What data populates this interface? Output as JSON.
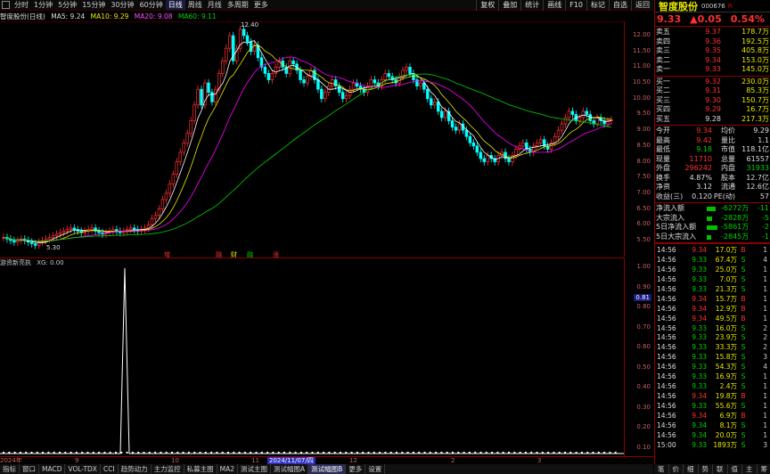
{
  "toolbar": {
    "periods": [
      "分时",
      "1分钟",
      "5分钟",
      "15分钟",
      "30分钟",
      "60分钟",
      "日线",
      "周线",
      "月线",
      "多周期",
      "更多"
    ],
    "active": "日线",
    "right": [
      "复权",
      "叠加",
      "统计",
      "画线",
      "F10",
      "标记",
      "自选",
      "返回"
    ]
  },
  "title": {
    "name": "智度股份(日线)",
    "ma5": "MA5: 9.24",
    "ma10": "MA10: 9.29",
    "ma20": "MA20: 9.08",
    "ma60": "MA60: 9.11"
  },
  "price_axis": [
    "12.00",
    "11.50",
    "11.00",
    "10.50",
    "10.00",
    "9.50",
    "9.00",
    "8.50",
    "8.00",
    "7.50",
    "7.00",
    "6.50",
    "6.00",
    "5.50"
  ],
  "markers": {
    "high": "12.40",
    "low": "5.30"
  },
  "events": [
    {
      "t": "增",
      "c": "#ff3030"
    },
    {
      "t": "融",
      "c": "#ff3030"
    },
    {
      "t": "财",
      "c": "#e8e800"
    },
    {
      "t": "融",
      "c": "#00d000"
    },
    {
      "t": "涨",
      "c": "#ff3030"
    }
  ],
  "indicator": {
    "name": "游资新亮执",
    "value": "XG: 0.00",
    "current": "0.81"
  },
  "sub_axis": [
    "1.00",
    "0.90",
    "0.80",
    "0.70",
    "0.60",
    "0.50",
    "0.40",
    "0.30",
    "0.20",
    "0.10"
  ],
  "dates": {
    "start": "2024年",
    "labels": [
      "9",
      "10",
      "11",
      "12",
      "2",
      "3"
    ],
    "current": "2024/11/07/四"
  },
  "bottom_tabs": [
    "指标",
    "窗口",
    "MACD",
    "VOL-TDX",
    "CCI",
    "趋势动力",
    "主力监控",
    "私募主图",
    "MA2",
    "测试主图",
    "测试幅图A",
    "测试幅图B",
    "更多",
    "设置"
  ],
  "bottom_active": "测试幅图B",
  "stock": {
    "name": "智度股份",
    "code": "000676",
    "r": "R",
    "price": "9.33",
    "change": "▲0.05",
    "pct": "0.54%"
  },
  "orderbook": {
    "asks": [
      [
        "卖五",
        "9.37",
        "178.7万"
      ],
      [
        "卖四",
        "9.36",
        "192.5万"
      ],
      [
        "卖三",
        "9.35",
        "405.8万"
      ],
      [
        "卖二",
        "9.34",
        "153.0万"
      ],
      [
        "卖一",
        "9.33",
        "145.0万"
      ]
    ],
    "bids": [
      [
        "买一",
        "9.32",
        "230.0万"
      ],
      [
        "买二",
        "9.31",
        "85.3万"
      ],
      [
        "买三",
        "9.30",
        "150.7万"
      ],
      [
        "买四",
        "9.29",
        "16.7万"
      ],
      [
        "买五",
        "9.28",
        "217.3万"
      ]
    ]
  },
  "quote": [
    [
      "今开",
      "9.34",
      "均价",
      "9.29"
    ],
    [
      "最高",
      "9.42",
      "量比",
      "1.1"
    ],
    [
      "最低",
      "9.18",
      "市值",
      "118.1亿"
    ],
    [
      "现量",
      "11710",
      "总量",
      "61557"
    ],
    [
      "外盘",
      "296242",
      "内盘",
      "31933"
    ],
    [
      "换手",
      "4.87%",
      "股本",
      "12.7亿"
    ],
    [
      "净资",
      "3.12",
      "流通",
      "12.6亿"
    ],
    [
      "收益(三)",
      "0.120",
      "PE(动)",
      "57"
    ]
  ],
  "flow": [
    {
      "label": "净流入额",
      "value": "-6272万",
      "pct": "-11",
      "w": 10
    },
    {
      "label": "大宗流入",
      "value": "-2828万",
      "pct": "-5",
      "w": 6
    },
    {
      "label": "5日净流入额",
      "value": "-5861万",
      "pct": "-2",
      "w": 12
    },
    {
      "label": "5日大宗流入",
      "value": "-2845万",
      "pct": "-1",
      "w": 5
    }
  ],
  "ticks": [
    [
      "14:56",
      "9.34",
      "17.0万",
      "B",
      "1"
    ],
    [
      "14:56",
      "9.33",
      "67.4万",
      "S",
      "4"
    ],
    [
      "14:56",
      "9.33",
      "25.0万",
      "S",
      "1"
    ],
    [
      "14:56",
      "9.33",
      "7.0万",
      "S",
      "1"
    ],
    [
      "14:56",
      "9.33",
      "21.3万",
      "S",
      "1"
    ],
    [
      "14:56",
      "9.34",
      "15.7万",
      "B",
      "1"
    ],
    [
      "14:56",
      "9.34",
      "12.9万",
      "B",
      "1"
    ],
    [
      "14:56",
      "9.34",
      "49.5万",
      "B",
      "1"
    ],
    [
      "14:56",
      "9.33",
      "16.0万",
      "S",
      "2"
    ],
    [
      "14:56",
      "9.33",
      "23.9万",
      "S",
      "2"
    ],
    [
      "14:56",
      "9.33",
      "33.3万",
      "S",
      "2"
    ],
    [
      "14:56",
      "9.33",
      "15.8万",
      "S",
      "3"
    ],
    [
      "14:56",
      "9.33",
      "54.3万",
      "S",
      "4"
    ],
    [
      "14:56",
      "9.33",
      "16.9万",
      "S",
      "1"
    ],
    [
      "14:56",
      "9.33",
      "2.4万",
      "S",
      "1"
    ],
    [
      "14:56",
      "9.34",
      "19.8万",
      "B",
      "1"
    ],
    [
      "14:56",
      "9.33",
      "55.6万",
      "S",
      "1"
    ],
    [
      "14:56",
      "9.34",
      "6.9万",
      "B",
      "1"
    ],
    [
      "14:56",
      "9.34",
      "8.1万",
      "S",
      "1"
    ],
    [
      "14:56",
      "9.34",
      "20.0万",
      "S",
      "1"
    ],
    [
      "15:00",
      "9.33",
      "1893万",
      "S",
      "3"
    ]
  ],
  "side_tabs": [
    "笔",
    "价",
    "细",
    "势",
    "联",
    "值",
    "主",
    "筹"
  ],
  "side_tabs2": [
    "日线"
  ],
  "colors": {
    "up": "#ff3030",
    "down": "#00ffff",
    "ma5": "#ffffff",
    "ma10": "#e8e800",
    "ma20": "#ff00ff",
    "ma60": "#00d000"
  }
}
